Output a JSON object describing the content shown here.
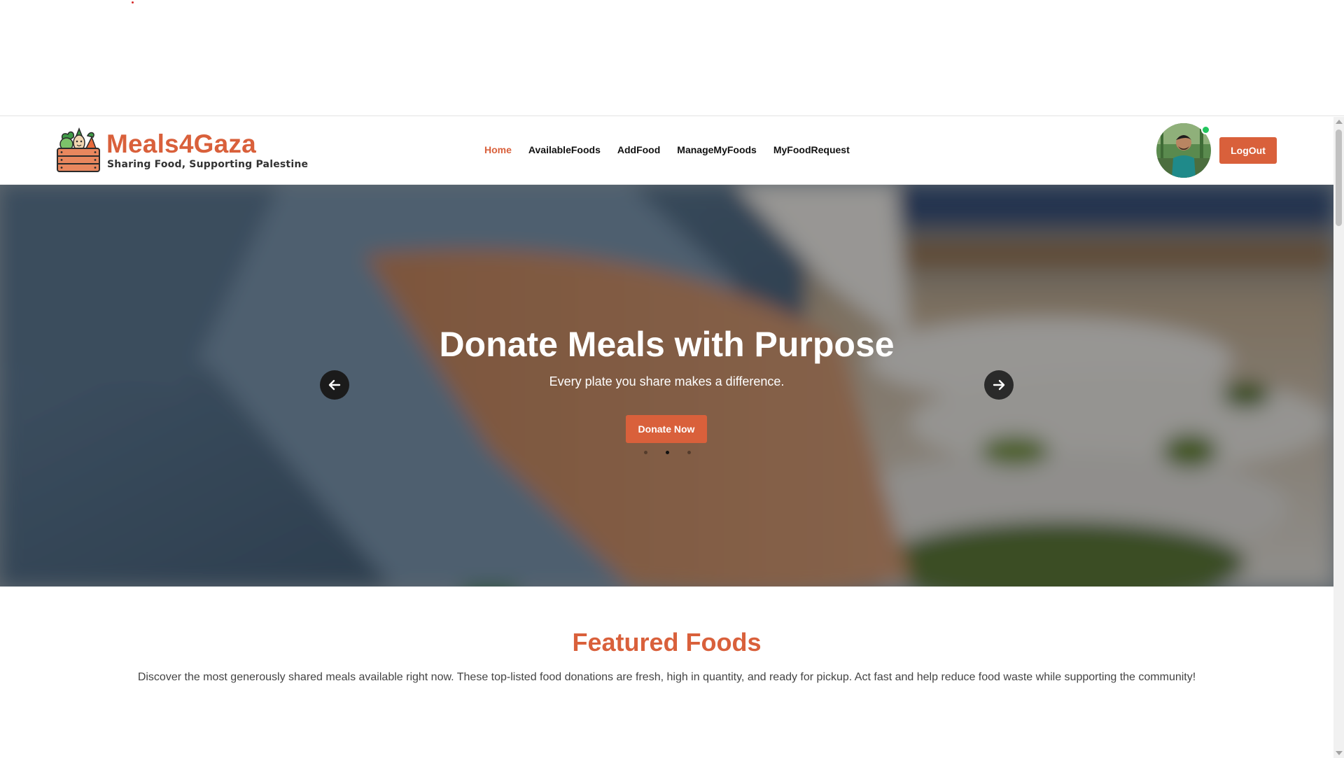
{
  "brand": {
    "title": "Meals4Gaza",
    "subtitle": "Sharing Food, Supporting Palestine",
    "logo_icon": "vegetable-crate-icon"
  },
  "nav": {
    "items": [
      {
        "label": "Home",
        "active": true
      },
      {
        "label": "AvailableFoods",
        "active": false
      },
      {
        "label": "AddFood",
        "active": false
      },
      {
        "label": "ManageMyFoods",
        "active": false
      },
      {
        "label": "MyFoodRequest",
        "active": false
      }
    ]
  },
  "user": {
    "avatar_icon": "user-avatar",
    "status": "online",
    "logout_label": "LogOut"
  },
  "hero": {
    "title": "Donate Meals with Purpose",
    "subtitle": "Every plate you share makes a difference.",
    "cta_label": "Donate Now",
    "slide_count": 3,
    "active_slide": 2,
    "prev_icon": "arrow-left-icon",
    "next_icon": "arrow-right-icon"
  },
  "featured": {
    "title": "Featured Foods",
    "description": "Discover the most generously shared meals available right now. These top-listed food donations are fresh, high in quantity, and ready for pickup. Act fast and help reduce food waste while supporting the community!"
  },
  "colors": {
    "accent": "#d9603b",
    "online": "#22c55e"
  }
}
